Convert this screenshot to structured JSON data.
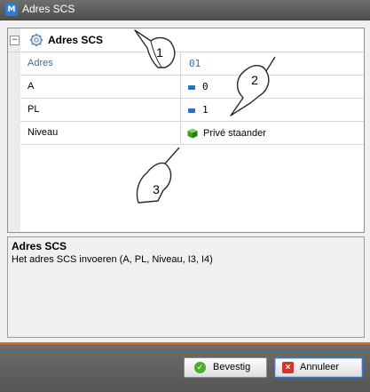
{
  "window": {
    "title": "Adres SCS"
  },
  "grid": {
    "section_title": "Adres SCS",
    "collapse_symbol": "⊟",
    "section_icon": "gear-icon",
    "rows": [
      {
        "name": "Adres",
        "value": "01",
        "selected": true
      },
      {
        "name": "A",
        "value": "0",
        "icon": "blue-dash-icon"
      },
      {
        "name": "PL",
        "value": "1",
        "icon": "blue-dash-icon"
      },
      {
        "name": "Niveau",
        "value": "Privé staander",
        "icon": "green-cube-icon"
      }
    ]
  },
  "description": {
    "title": "Adres SCS",
    "text": "Het adres SCS invoeren (A, PL, Niveau, I3, I4)"
  },
  "buttons": {
    "confirm": "Bevestig",
    "cancel": "Annuleer"
  },
  "callouts": [
    "1",
    "2",
    "3"
  ],
  "colors": {
    "accent": "#e46b2b",
    "selected_text": "#3c6ea8",
    "titlebar": "#5a5a5a"
  }
}
